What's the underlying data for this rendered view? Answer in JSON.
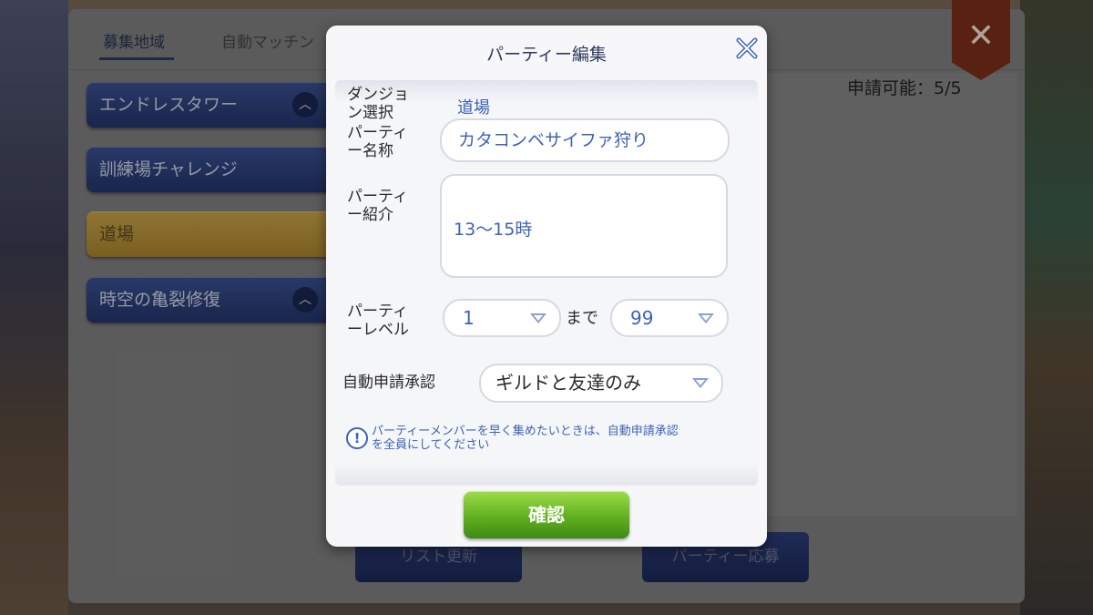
{
  "tabs": [
    "募集地域",
    "自動マッチン"
  ],
  "regions": [
    {
      "label": "エンドレスタワー",
      "chevron": "chevron-up-icon"
    },
    {
      "label": "訓練場チャレンジ"
    },
    {
      "label": "道場"
    },
    {
      "label": "時空の亀裂修復",
      "chevron": "chevron-up-icon"
    }
  ],
  "applicable": "申請可能：5/5",
  "bottom_buttons": {
    "refresh": "リスト更新",
    "apply": "パーティー応募"
  },
  "modal": {
    "title": "パーティー編集",
    "dungeon_label_1": "ダンジョ",
    "dungeon_label_2": "ン選択",
    "dungeon_value": "道場",
    "party_name_label_1": "パーティ",
    "party_name_label_2": "ー名称",
    "party_name_value": "カタコンベサイファ狩り",
    "intro_label_1": "パーティ",
    "intro_label_2": "ー紹介",
    "intro_value": "13～15時",
    "level_label_1": "パーティ",
    "level_label_2": "ーレベル",
    "level_min": "1",
    "level_to": "まで",
    "level_max": "99",
    "auto_approve_label": "自動申請承認",
    "auto_approve_value": "ギルドと友達のみ",
    "note_1": "パーティーメンバーを早く集めたいときは、自動申請承認",
    "note_2": "を全員にしてください",
    "confirm": "確認"
  },
  "colors": {
    "accent_blue": "#3b63b8",
    "confirm_green": "#61b020",
    "region_active": "#c7a24a"
  }
}
